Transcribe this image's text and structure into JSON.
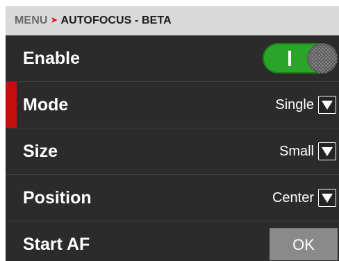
{
  "breadcrumb": {
    "root": "MENU",
    "separator": "➤",
    "current": "AUTOFOCUS - BETA"
  },
  "rows": {
    "enable": {
      "label": "Enable",
      "toggle_state": "on",
      "toggle_color": "#2aa52a"
    },
    "mode": {
      "label": "Mode",
      "value": "Single",
      "icon": "chevron-down-icon"
    },
    "size": {
      "label": "Size",
      "value": "Small",
      "icon": "chevron-down-icon"
    },
    "position": {
      "label": "Position",
      "value": "Center",
      "icon": "chevron-down-icon"
    },
    "start_af": {
      "label": "Start AF",
      "button_label": "OK"
    }
  },
  "colors": {
    "accent_red": "#c40d0d",
    "background": "#2b2b2b",
    "header_bg": "#d9d9d9"
  }
}
